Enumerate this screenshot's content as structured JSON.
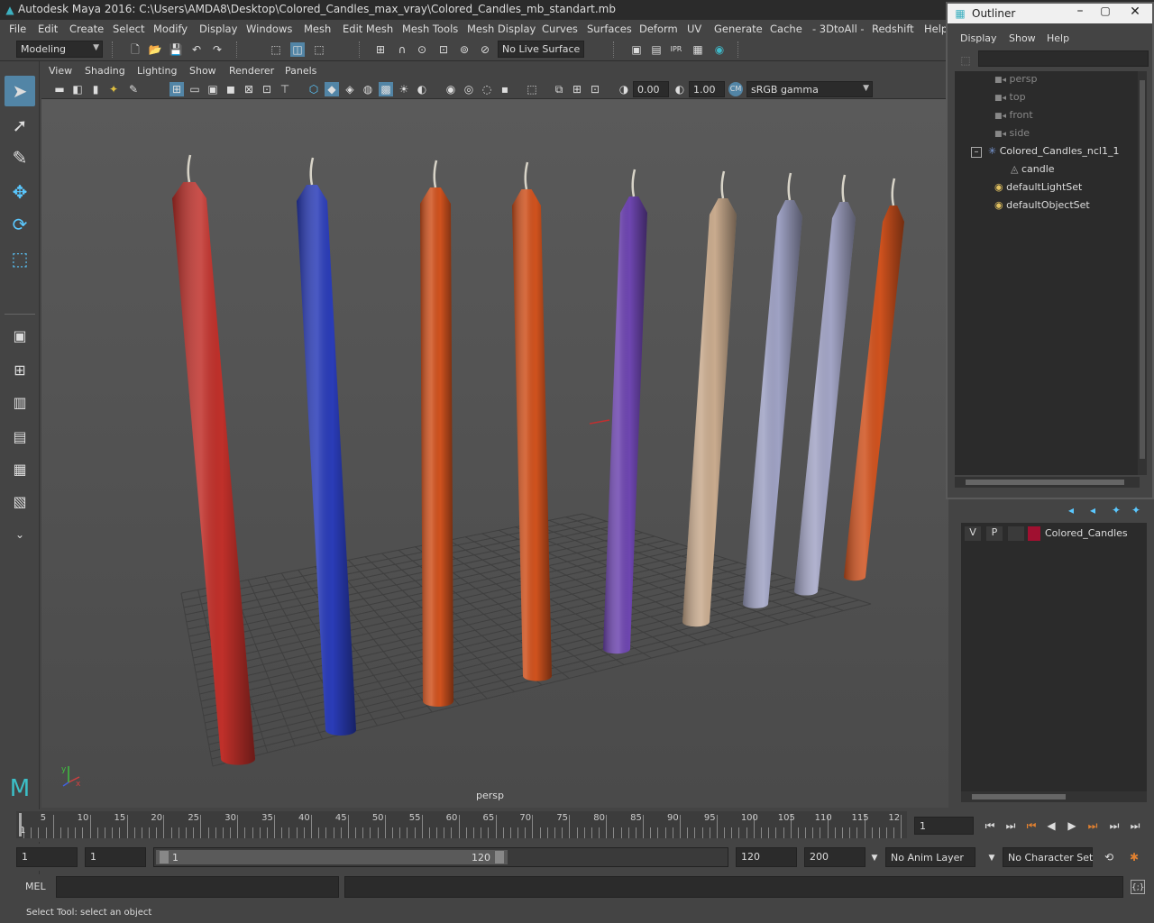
{
  "window": {
    "title": "Autodesk Maya 2016: C:\\Users\\AMDA8\\Desktop\\Colored_Candles_max_vray\\Colored_Candles_mb_standart.mb"
  },
  "menu": [
    "File",
    "Edit",
    "Create",
    "Select",
    "Modify",
    "Display",
    "Windows",
    "Mesh",
    "Edit Mesh",
    "Mesh Tools",
    "Mesh Display",
    "Curves",
    "Surfaces",
    "Deform",
    "UV",
    "Generate",
    "Cache",
    "- 3DtoAll -",
    "Redshift",
    "Help"
  ],
  "shelf": {
    "mode": "Modeling",
    "live_surface": "No Live Surface"
  },
  "panel_menu": [
    "View",
    "Shading",
    "Lighting",
    "Show",
    "Renderer",
    "Panels"
  ],
  "panel_toolbar": {
    "exposure": "0.00",
    "gamma": "1.00",
    "color_space": "sRGB gamma"
  },
  "viewport": {
    "camera_label": "persp"
  },
  "candles": [
    {
      "color": "#c0302a"
    },
    {
      "color": "#2a3cb8"
    },
    {
      "color": "#d0521e"
    },
    {
      "color": "#d0521e"
    },
    {
      "color": "#6e46b0"
    },
    {
      "color": "#c9ab8e"
    },
    {
      "color": "#9fa2c4"
    },
    {
      "color": "#a3a5c6"
    },
    {
      "color": "#d0521e"
    }
  ],
  "outliner": {
    "title": "Outliner",
    "menu": [
      "Display",
      "Show",
      "Help"
    ],
    "items": [
      {
        "label": "persp",
        "icon": "camera-icon"
      },
      {
        "label": "top",
        "icon": "camera-icon"
      },
      {
        "label": "front",
        "icon": "camera-icon"
      },
      {
        "label": "side",
        "icon": "camera-icon"
      },
      {
        "label": "Colored_Candles_ncl1_1",
        "icon": "group-icon"
      },
      {
        "label": "candle",
        "icon": "mesh-icon"
      },
      {
        "label": "defaultLightSet",
        "icon": "set-icon"
      },
      {
        "label": "defaultObjectSet",
        "icon": "set-icon"
      }
    ]
  },
  "layer": {
    "v": "V",
    "p": "P",
    "name": "Colored_Candles",
    "color": "#a01030"
  },
  "timeline": {
    "ticks": [
      "5",
      "10",
      "15",
      "20",
      "25",
      "30",
      "35",
      "40",
      "45",
      "50",
      "55",
      "60",
      "65",
      "70",
      "75",
      "80",
      "85",
      "90",
      "95",
      "100",
      "105",
      "110",
      "115",
      "12"
    ],
    "start_tick": "1",
    "current_frame": "1"
  },
  "range": {
    "start": "1",
    "start2": "1",
    "slider_start": "1",
    "slider_end": "120",
    "end": "120",
    "end2": "200",
    "anim_layer": "No Anim Layer",
    "char_set": "No Character Set"
  },
  "cmd": {
    "label": "MEL"
  },
  "help": {
    "text": "Select Tool: select an object"
  }
}
